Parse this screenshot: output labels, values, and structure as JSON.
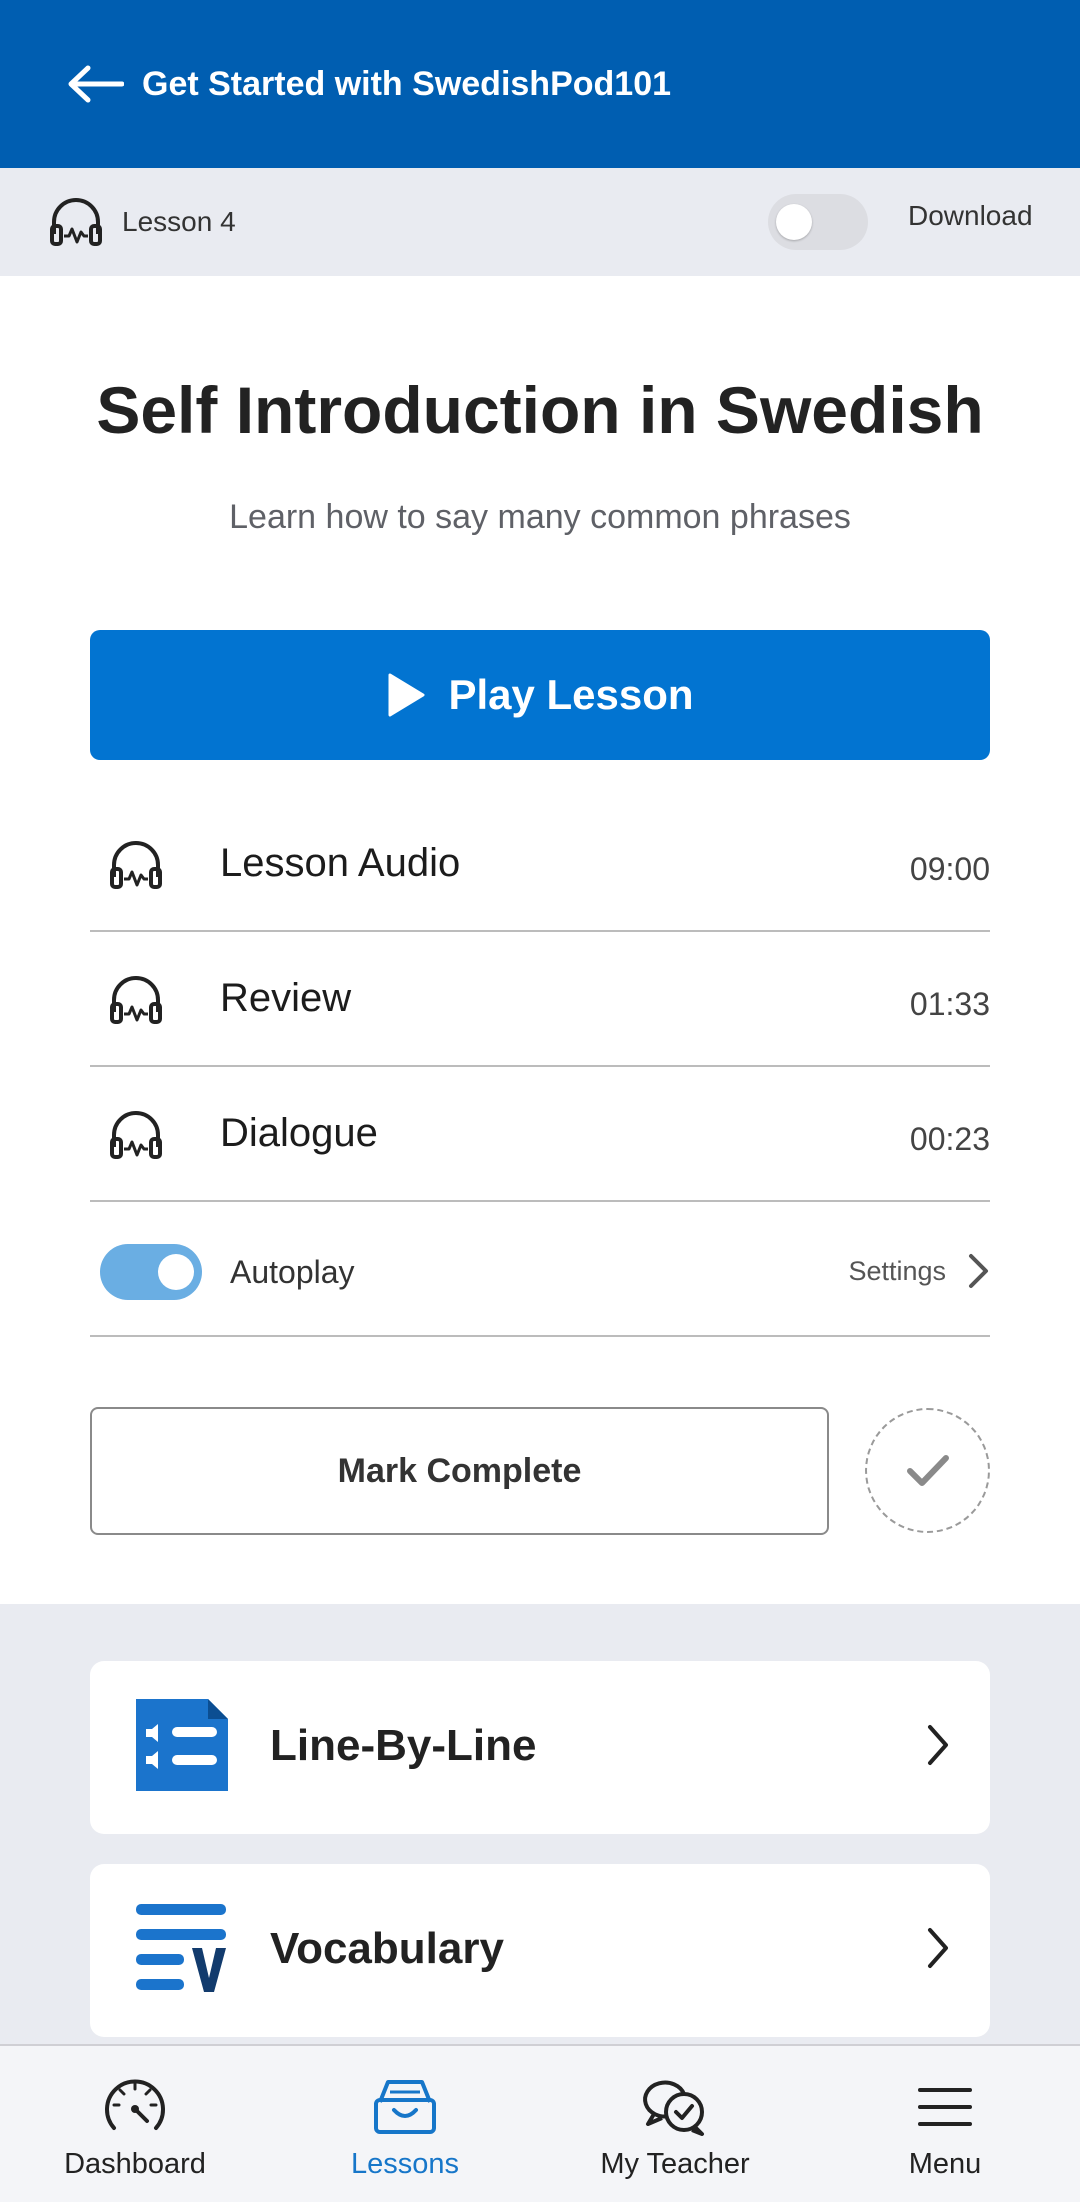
{
  "header": {
    "title": "Get Started with SwedishPod101",
    "back_icon": "arrow-left-icon"
  },
  "subbar": {
    "lesson_label": "Lesson 4",
    "download_label": "Download",
    "download_on": false
  },
  "lesson": {
    "title": "Self Introduction in Swedish",
    "subtitle": "Learn how to say many common phrases",
    "play_label": "Play Lesson"
  },
  "audio_tracks": [
    {
      "name": "Lesson Audio",
      "duration": "09:00"
    },
    {
      "name": "Review",
      "duration": "01:33"
    },
    {
      "name": "Dialogue",
      "duration": "00:23"
    }
  ],
  "autoplay": {
    "label": "Autoplay",
    "on": true,
    "settings_label": "Settings"
  },
  "mark_complete": {
    "label": "Mark Complete"
  },
  "cards": [
    {
      "label": "Line-By-Line",
      "icon": "line-by-line-icon"
    },
    {
      "label": "Vocabulary",
      "icon": "vocabulary-icon"
    }
  ],
  "bottom_nav": [
    {
      "label": "Dashboard",
      "icon": "dashboard-gauge-icon",
      "active": false
    },
    {
      "label": "Lessons",
      "icon": "lessons-box-icon",
      "active": true
    },
    {
      "label": "My Teacher",
      "icon": "chat-bubbles-icon",
      "active": false
    },
    {
      "label": "Menu",
      "icon": "hamburger-menu-icon",
      "active": false
    }
  ],
  "colors": {
    "header": "#005eb1",
    "accent": "#0274d1",
    "active_nav": "#1676c9",
    "toggle_on": "#6aaee3"
  }
}
